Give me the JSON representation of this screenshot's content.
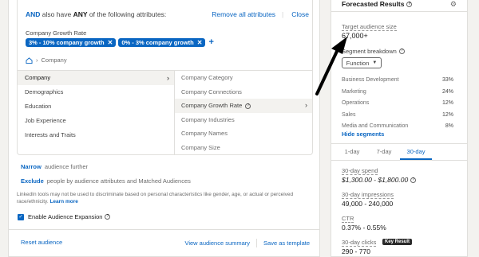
{
  "attributes": {
    "and": "AND",
    "header_text_1": "also have",
    "any": "ANY",
    "header_text_2": "of the following attributes:",
    "remove_all": "Remove all attributes",
    "close": "Close",
    "category_label": "Company Growth Rate",
    "chips": [
      "3% - 10% company growth",
      "0% - 3% company growth"
    ],
    "breadcrumb": "Company"
  },
  "categories": [
    "Company",
    "Demographics",
    "Education",
    "Job Experience",
    "Interests and Traits"
  ],
  "subcategories": [
    "Company Category",
    "Company Connections",
    "Company Growth Rate",
    "Company Industries",
    "Company Names",
    "Company Size"
  ],
  "narrow": {
    "action": "Narrow",
    "text": "audience further"
  },
  "exclude": {
    "action": "Exclude",
    "text": "people by audience attributes and Matched Audiences"
  },
  "disclaimer": {
    "text": "LinkedIn tools may not be used to discriminate based on personal characteristics like gender, age, or actual or perceived race/ethnicity.",
    "link": "Learn more"
  },
  "expansion_label": "Enable Audience Expansion",
  "footer": {
    "reset": "Reset audience",
    "summary": "View audience summary",
    "save": "Save as template"
  },
  "forecast": {
    "title": "Forecasted Results",
    "target_label": "Target audience size",
    "target_value": "67,000+",
    "segment_label": "Segment breakdown",
    "function_btn": "Function",
    "segments": [
      {
        "name": "Business Development",
        "pct": "33%"
      },
      {
        "name": "Marketing",
        "pct": "24%"
      },
      {
        "name": "Operations",
        "pct": "12%"
      },
      {
        "name": "Sales",
        "pct": "12%"
      },
      {
        "name": "Media and Communication",
        "pct": "8%"
      }
    ],
    "hide_segments": "Hide segments",
    "tabs": [
      "1-day",
      "7-day",
      "30-day"
    ],
    "metrics": [
      {
        "label": "30-day spend",
        "value": "$1,300.00 - $1,800.00"
      },
      {
        "label": "30-day impressions",
        "value": "49,000 - 240,000"
      },
      {
        "label": "CTR",
        "value": "0.37% - 0.55%"
      },
      {
        "label": "30-day clicks",
        "value": "290 - 770"
      }
    ],
    "key_result": "Key Result"
  },
  "colors": {
    "accent": "#0a66c2",
    "background": "#f3f2ef",
    "badge": "#2a2a2a"
  }
}
